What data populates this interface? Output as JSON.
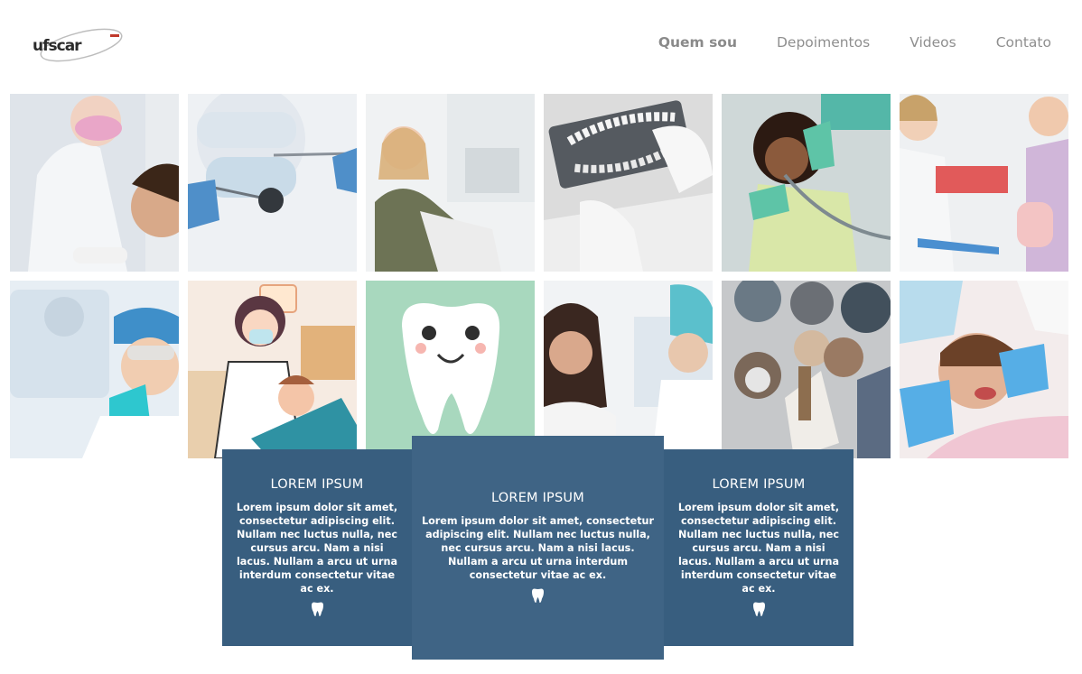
{
  "header": {
    "logo_alt": "ufscar",
    "nav": [
      {
        "label": "Quem sou",
        "active": true
      },
      {
        "label": "Depoimentos",
        "active": false
      },
      {
        "label": "Videos",
        "active": false
      },
      {
        "label": "Contato",
        "active": false
      }
    ]
  },
  "gallery": {
    "images": [
      "dentist-with-patient-photo",
      "dental-tools-closeup-photo",
      "smiling-patient-in-chair-photo",
      "dental-xray-photo",
      "child-treatment-photo",
      "dentist-with-boy-photo",
      "smiling-assistant-photo",
      "dentist-cartoon-illustration",
      "tooth-cartoon-illustration",
      "smiling-woman-photo",
      "dentists-looking-down-photo",
      "boy-in-dental-chair-photo"
    ]
  },
  "cards": [
    {
      "title": "LOREM IPSUM",
      "text": "Lorem ipsum dolor sit amet, consectetur adipiscing elit. Nullam nec luctus nulla, nec cursus arcu. Nam a nisi lacus. Nullam a arcu ut urna interdum consectetur vitae ac ex.",
      "icon": "tooth-icon"
    },
    {
      "title": "LOREM IPSUM",
      "text": "Lorem ipsum dolor sit amet, consectetur adipiscing elit. Nullam nec luctus nulla, nec cursus arcu. Nam a nisi lacus. Nullam a arcu ut urna interdum consectetur vitae ac ex.",
      "icon": "tooth-icon"
    },
    {
      "title": "LOREM IPSUM",
      "text": "Lorem ipsum dolor sit amet, consectetur adipiscing elit. Nullam nec luctus nulla, nec cursus arcu. Nam a nisi lacus. Nullam a arcu ut urna interdum consectetur vitae ac ex.",
      "icon": "tooth-icon"
    }
  ],
  "colors": {
    "card_dark": "#385e7f",
    "card_mid": "#3f6485",
    "nav_text": "#8f8f8f"
  }
}
